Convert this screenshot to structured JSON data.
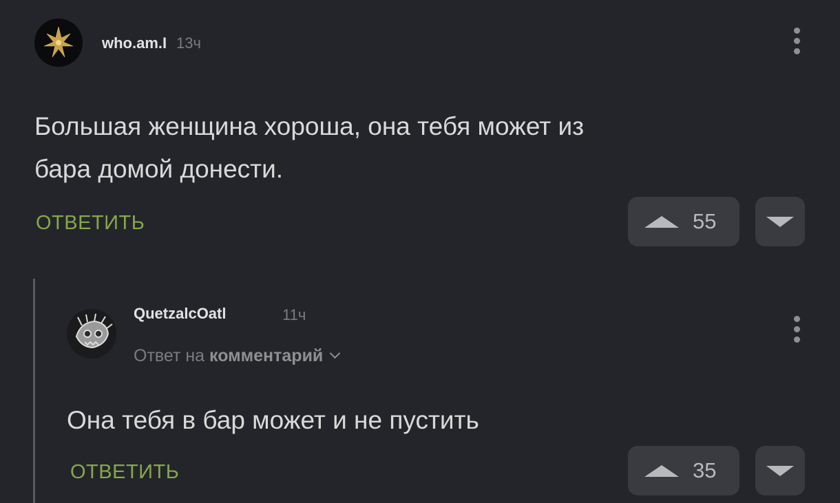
{
  "comment": {
    "username": "who.am.I",
    "time": "13ч",
    "text_line1": "Большая женщина хороша, она тебя может из",
    "text_line2": "бара домой донести.",
    "reply_label": "ОТВЕТИТЬ",
    "upvotes": "55",
    "avatar_icon": "golden-leaf-icon"
  },
  "reply": {
    "username": "QuetzalcOatl",
    "time": "11ч",
    "reply_to_prefix": "Ответ на",
    "reply_to_target": "комментарий",
    "text": "Она тебя в бар может и не пустить",
    "reply_label": "ОТВЕТИТЬ",
    "upvotes": "35",
    "avatar_icon": "dragon-skull-icon"
  },
  "colors": {
    "background": "#24252a",
    "accent_green": "#86a84a",
    "vote_box": "#3a3b40"
  }
}
